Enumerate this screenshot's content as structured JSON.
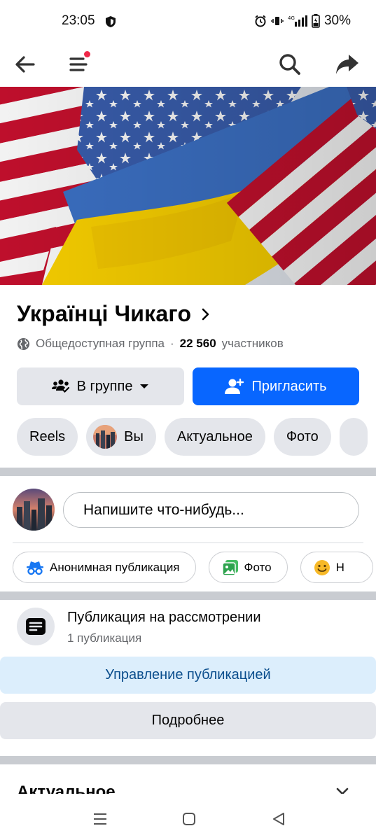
{
  "status_bar": {
    "time": "23:05",
    "battery": "30%",
    "network": "4G"
  },
  "app_bar": {
    "back_icon": "arrow-left-icon",
    "menu_icon": "hamburger-menu-icon",
    "search_icon": "search-icon",
    "share_icon": "share-arrow-icon",
    "notification_dot_color": "#f02849"
  },
  "cover": {
    "description_icon": "flags-cover-image"
  },
  "group": {
    "title": "Українці Чикаго",
    "privacy": "Общедоступная группа",
    "separator": "·",
    "members_count": "22 560",
    "members_label": "участников"
  },
  "buttons": {
    "joined_label": "В группе",
    "invite_label": "Пригласить"
  },
  "chips": [
    {
      "label": "Reels"
    },
    {
      "label": "Вы"
    },
    {
      "label": "Актуальное"
    },
    {
      "label": "Фото"
    }
  ],
  "composer": {
    "placeholder": "Напишите что-нибудь..."
  },
  "composer_actions": [
    {
      "label": "Анонимная публикация",
      "icon": "incognito-icon"
    },
    {
      "label": "Фото",
      "icon": "photo-icon"
    },
    {
      "label": "Н",
      "icon": "emoji-icon"
    }
  ],
  "pending": {
    "title": "Публикация на рассмотрении",
    "subtitle": "1 публикация",
    "manage_label": "Управление публикацией",
    "more_label": "Подробнее"
  },
  "next_section": {
    "title": "Актуальное"
  },
  "colors": {
    "primary": "#0866ff",
    "secondary_button": "#e4e6eb",
    "manage_bg": "#dceefc",
    "manage_text": "#0a4d8c"
  }
}
